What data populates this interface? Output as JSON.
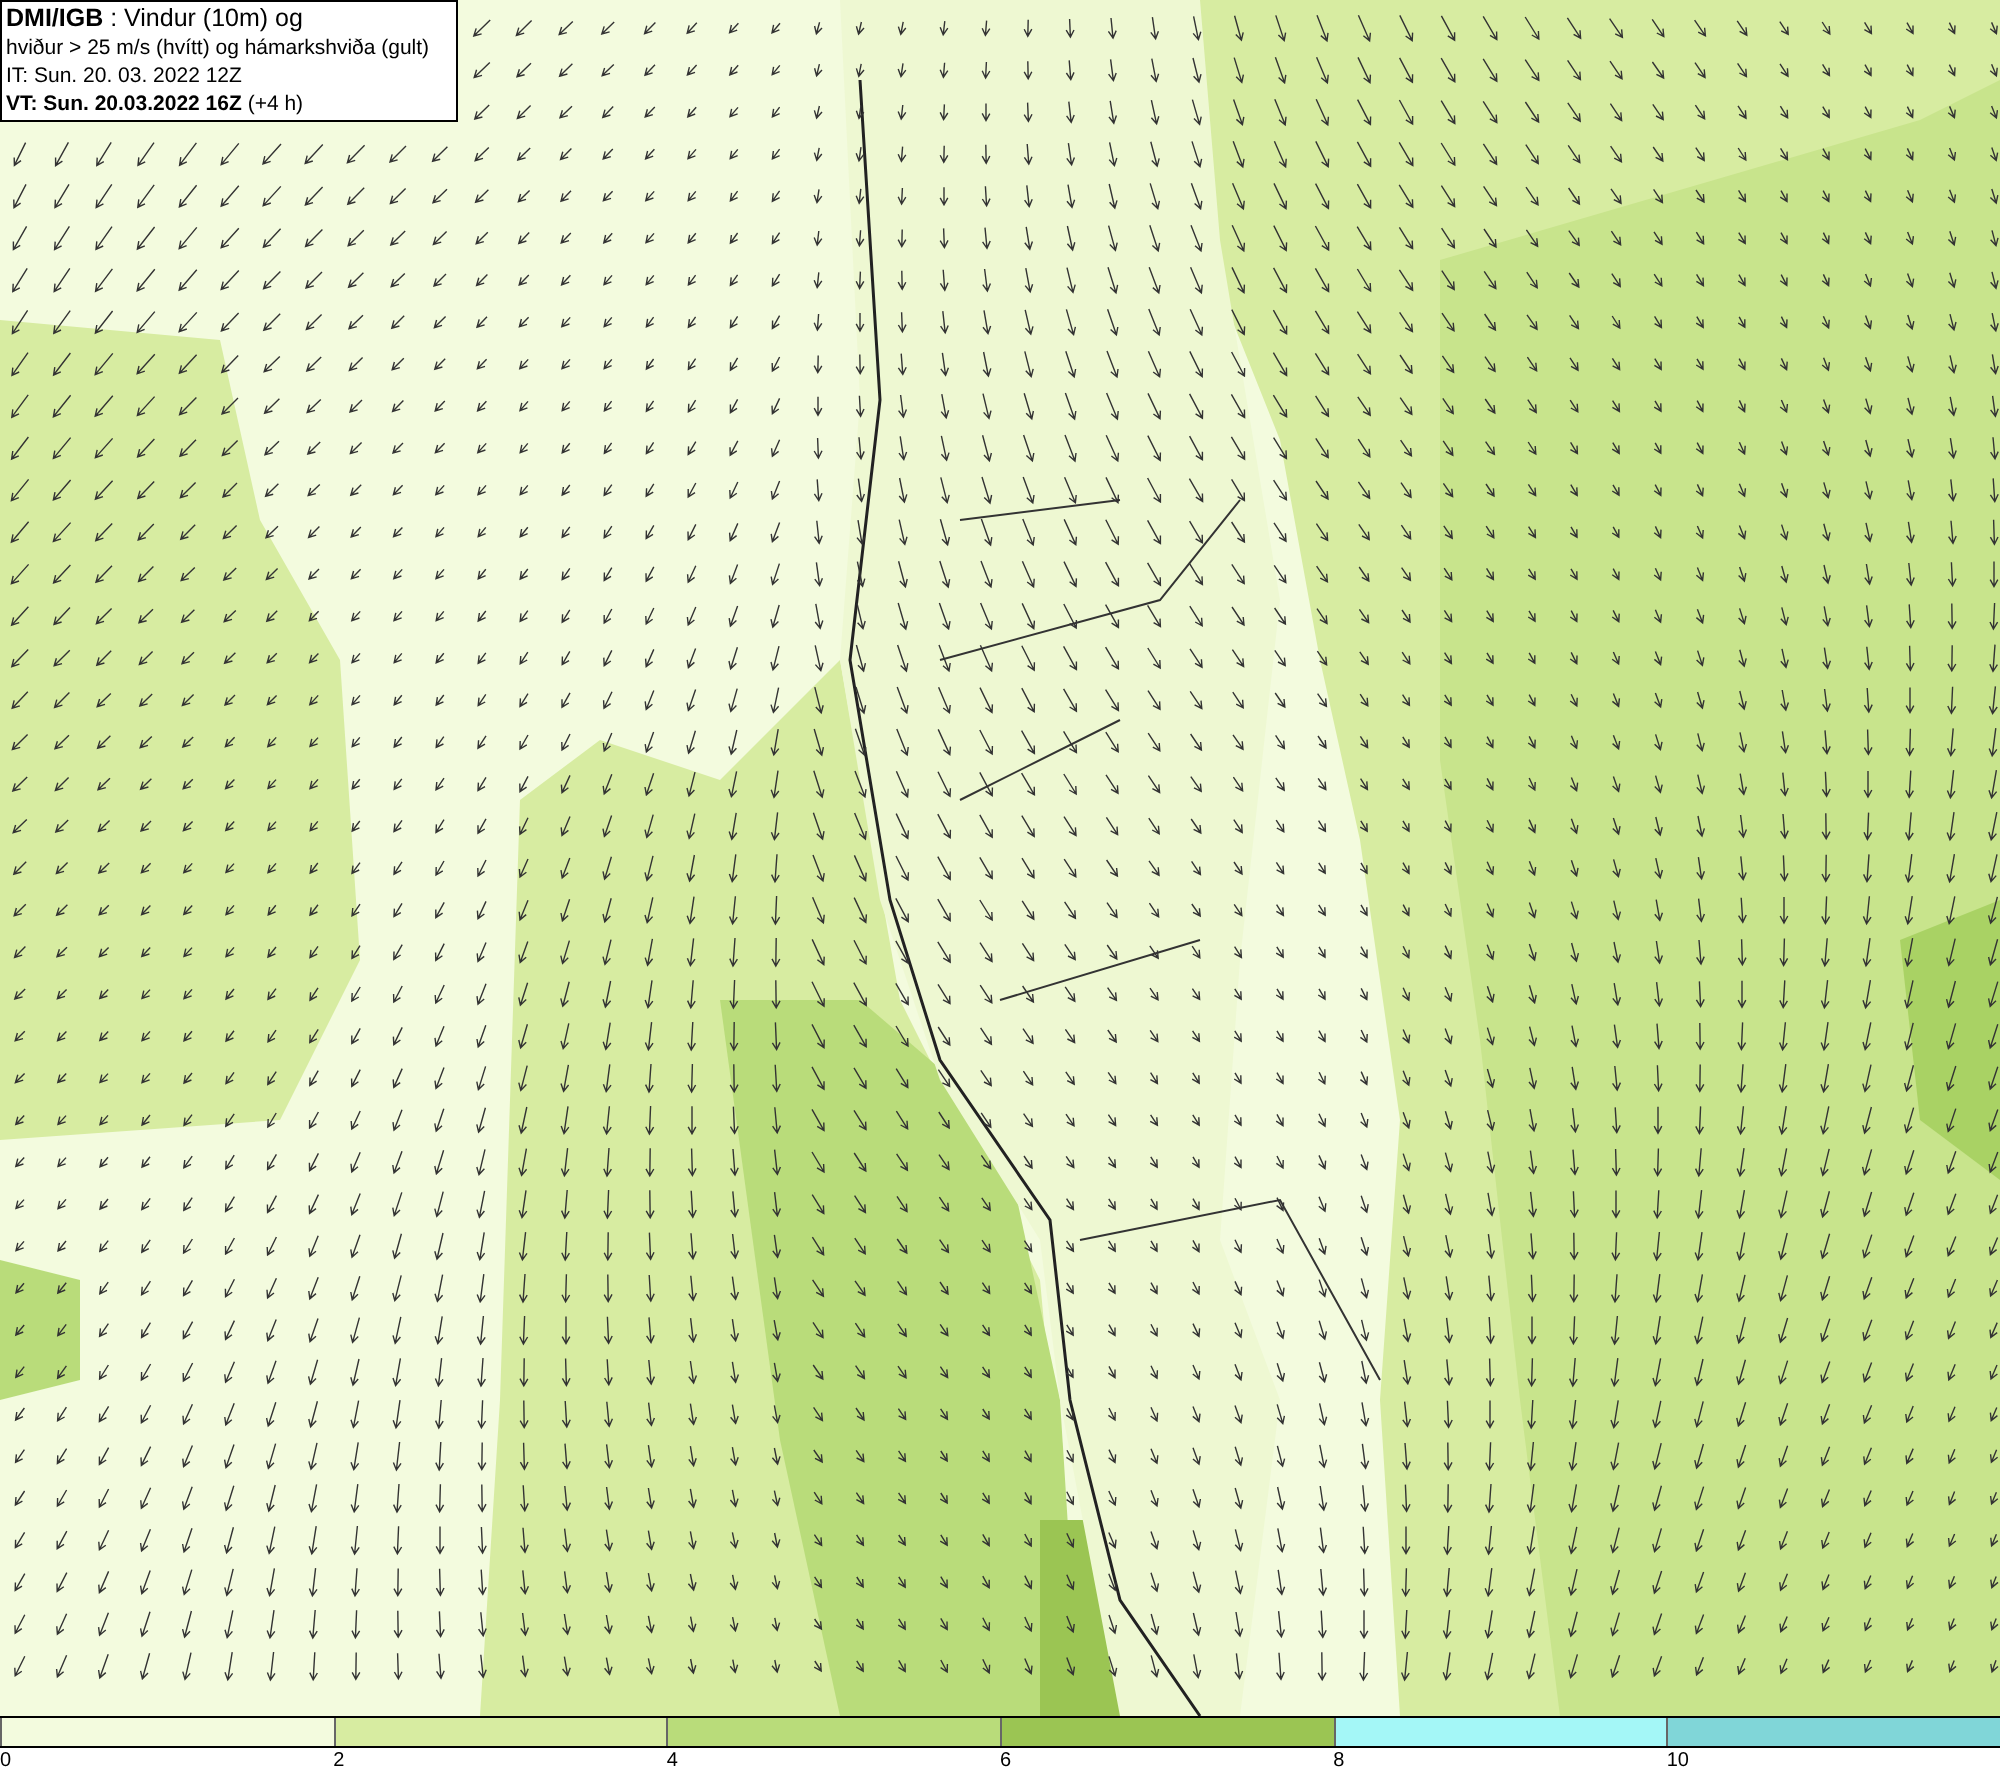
{
  "header": {
    "lines": [
      "**DMI/IGB** : Vindur (10m) og",
      "hviður > 25 m/s (hvítt) og hámarkshviða (gult)",
      "IT: Sun. 20. 03. 2022 12Z",
      "**VT: Sun. 20.03.2022 16Z** (+4 h)"
    ]
  },
  "colorbar": {
    "segments": [
      {
        "label": "0",
        "color": "#f3fbde"
      },
      {
        "label": "2",
        "color": "#d7eca1"
      },
      {
        "label": "4",
        "color": "#b9dc7a"
      },
      {
        "label": "6",
        "color": "#9bc553"
      },
      {
        "label": "8",
        "color": "#a4f7f7"
      },
      {
        "label": "10",
        "color": "#80d6d8"
      }
    ]
  }
}
